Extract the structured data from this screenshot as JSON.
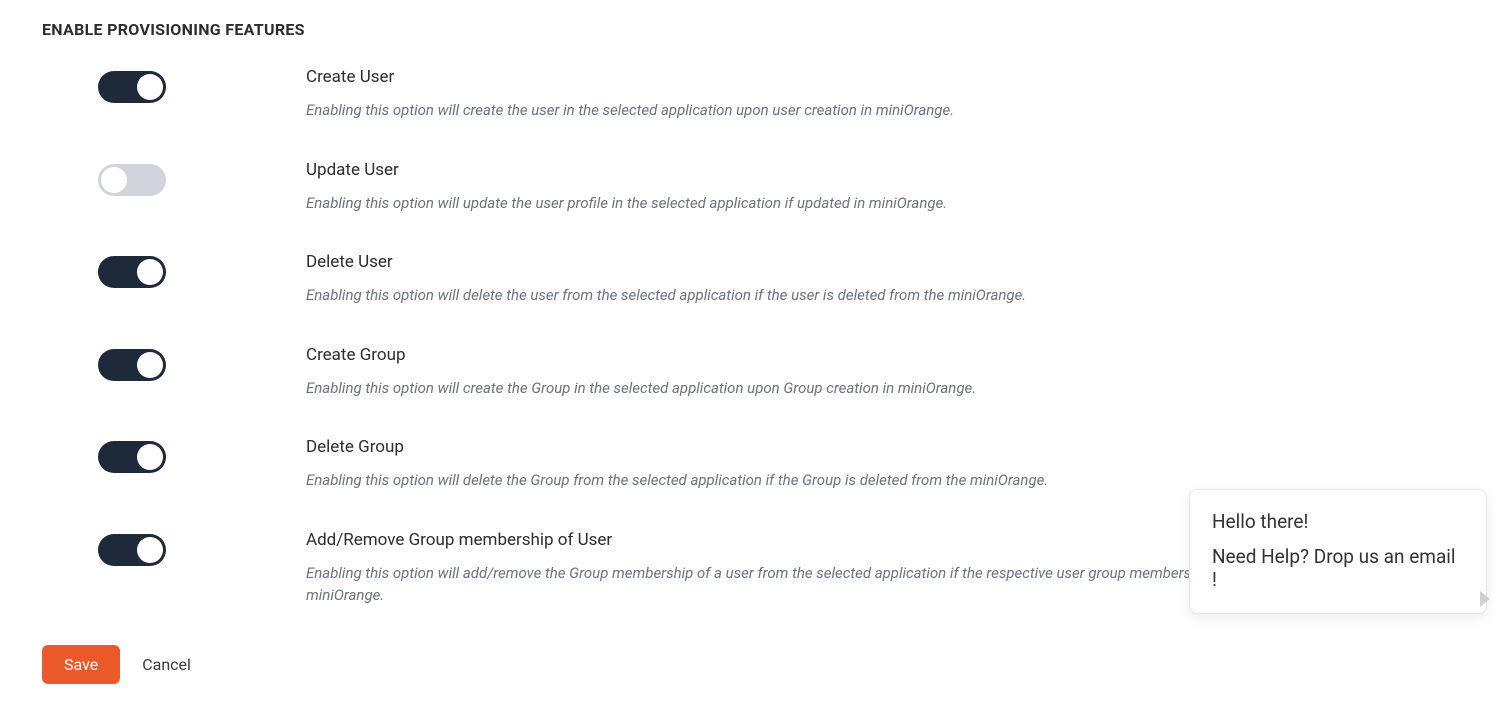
{
  "section_title": "ENABLE PROVISIONING FEATURES",
  "features": [
    {
      "key": "create-user",
      "title": "Create User",
      "desc": "Enabling this option will create the user in the selected application upon user creation in miniOrange.",
      "enabled": true
    },
    {
      "key": "update-user",
      "title": "Update User",
      "desc": "Enabling this option will update the user profile in the selected application if updated in miniOrange.",
      "enabled": false
    },
    {
      "key": "delete-user",
      "title": "Delete User",
      "desc": "Enabling this option will delete the user from the selected application if the user is deleted from the miniOrange.",
      "enabled": true
    },
    {
      "key": "create-group",
      "title": "Create Group",
      "desc": "Enabling this option will create the Group in the selected application upon Group creation in miniOrange.",
      "enabled": true
    },
    {
      "key": "delete-group",
      "title": "Delete Group",
      "desc": "Enabling this option will delete the Group from the selected application if the Group is deleted from the miniOrange.",
      "enabled": true
    },
    {
      "key": "group-membership",
      "title": "Add/Remove Group membership of User",
      "desc": "Enabling this option will add/remove the Group membership of a user from the selected application if the respective user group membership is updated from the miniOrange.",
      "enabled": true
    }
  ],
  "actions": {
    "save_label": "Save",
    "cancel_label": "Cancel"
  },
  "help": {
    "line1": "Hello there!",
    "line2": "Need Help? Drop us an email !"
  },
  "colors": {
    "toggle_on": "#1e2a3a",
    "toggle_off": "#d1d5db",
    "accent": "#eb5a29"
  }
}
